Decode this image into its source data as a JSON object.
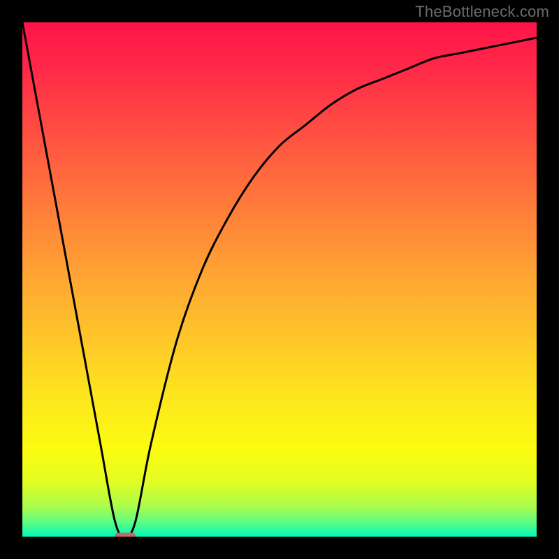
{
  "watermark": "TheBottleneck.com",
  "chart_data": {
    "type": "line",
    "title": "",
    "xlabel": "",
    "ylabel": "",
    "xlim": [
      0,
      100
    ],
    "ylim": [
      0,
      100
    ],
    "series": [
      {
        "name": "curve",
        "x": [
          0,
          5,
          10,
          15,
          18,
          20,
          22,
          25,
          30,
          35,
          40,
          45,
          50,
          55,
          60,
          65,
          70,
          75,
          80,
          85,
          90,
          95,
          100
        ],
        "y": [
          100,
          73,
          46,
          19,
          3,
          0,
          3,
          18,
          38,
          52,
          62,
          70,
          76,
          80,
          84,
          87,
          89,
          91,
          93,
          94,
          95,
          96,
          97
        ]
      }
    ],
    "marker": {
      "x": 20,
      "y": 0
    },
    "background": {
      "type": "vertical-gradient",
      "stops": [
        {
          "offset": 0.0,
          "color": "#ff1449"
        },
        {
          "offset": 0.09,
          "color": "#ff2948"
        },
        {
          "offset": 0.5,
          "color": "#ffa733"
        },
        {
          "offset": 0.72,
          "color": "#fde31f"
        },
        {
          "offset": 0.83,
          "color": "#fcfc0f"
        },
        {
          "offset": 0.89,
          "color": "#e4fd21"
        },
        {
          "offset": 0.94,
          "color": "#acfd4a"
        },
        {
          "offset": 0.97,
          "color": "#65fc7e"
        },
        {
          "offset": 1.0,
          "color": "#00f8b9"
        }
      ]
    },
    "curve_color": "#000000",
    "marker_color": "#cc6666"
  }
}
